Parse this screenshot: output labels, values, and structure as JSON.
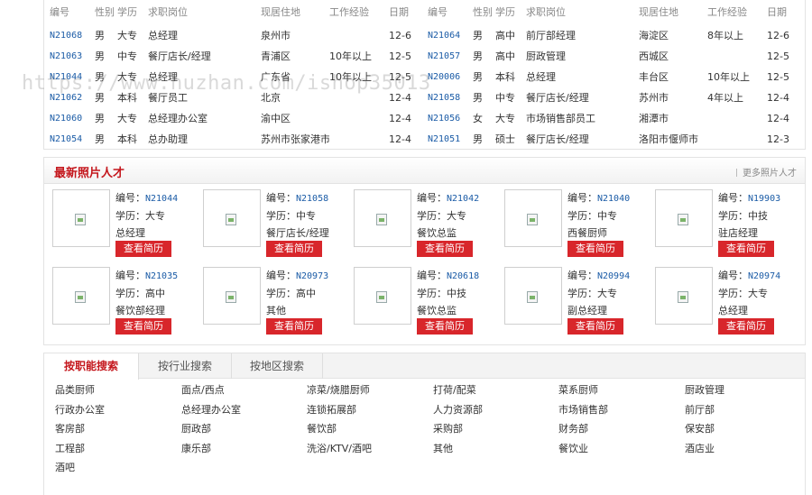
{
  "resume_table": {
    "headers": {
      "id": "编号",
      "sex": "性别",
      "edu": "学历",
      "position": "求职岗位",
      "location": "现居住地",
      "experience": "工作经验",
      "date": "日期"
    },
    "left_rows": [
      {
        "id": "N21068",
        "sex": "男",
        "edu": "大专",
        "position": "总经理",
        "location": "泉州市",
        "experience": "",
        "date": "12-6"
      },
      {
        "id": "N21063",
        "sex": "男",
        "edu": "中专",
        "position": "餐厅店长/经理",
        "location": "青浦区",
        "experience": "10年以上",
        "date": "12-5"
      },
      {
        "id": "N21044",
        "sex": "男",
        "edu": "大专",
        "position": "总经理",
        "location": "广东省",
        "experience": "10年以上",
        "date": "12-5"
      },
      {
        "id": "N21062",
        "sex": "男",
        "edu": "本科",
        "position": "餐厅员工",
        "location": "北京",
        "experience": "",
        "date": "12-4"
      },
      {
        "id": "N21060",
        "sex": "男",
        "edu": "大专",
        "position": "总经理办公室",
        "location": "渝中区",
        "experience": "",
        "date": "12-4"
      },
      {
        "id": "N21054",
        "sex": "男",
        "edu": "本科",
        "position": "总办助理",
        "location": "苏州市张家港市",
        "experience": "",
        "date": "12-4"
      }
    ],
    "right_rows": [
      {
        "id": "N21064",
        "sex": "男",
        "edu": "高中",
        "position": "前厅部经理",
        "location": "海淀区",
        "experience": "8年以上",
        "date": "12-6"
      },
      {
        "id": "N21057",
        "sex": "男",
        "edu": "高中",
        "position": "厨政管理",
        "location": "西城区",
        "experience": "",
        "date": "12-5"
      },
      {
        "id": "N20006",
        "sex": "男",
        "edu": "本科",
        "position": "总经理",
        "location": "丰台区",
        "experience": "10年以上",
        "date": "12-5"
      },
      {
        "id": "N21058",
        "sex": "男",
        "edu": "中专",
        "position": "餐厅店长/经理",
        "location": "苏州市",
        "experience": "4年以上",
        "date": "12-4"
      },
      {
        "id": "N21056",
        "sex": "女",
        "edu": "大专",
        "position": "市场销售部员工",
        "location": "湘潭市",
        "experience": "",
        "date": "12-4"
      },
      {
        "id": "N21051",
        "sex": "男",
        "edu": "硕士",
        "position": "餐厅店长/经理",
        "location": "洛阳市偃师市",
        "experience": "",
        "date": "12-3"
      }
    ]
  },
  "watermark": "https://www.huzhan.com/ishop35013",
  "photo_section": {
    "title": "最新照片人才",
    "more_link": "更多照片人才",
    "button_label": "查看简历",
    "cards": [
      {
        "num_label": "编号：",
        "num": "N21044",
        "edu": "学历：大专",
        "position": "总经理"
      },
      {
        "num_label": "编号：",
        "num": "N21058",
        "edu": "学历：中专",
        "position": "餐厅店长/经理"
      },
      {
        "num_label": "编号：",
        "num": "N21042",
        "edu": "学历：大专",
        "position": "餐饮总监"
      },
      {
        "num_label": "编号：",
        "num": "N21040",
        "edu": "学历：中专",
        "position": "西餐厨师"
      },
      {
        "num_label": "编号：",
        "num": "N19903",
        "edu": "学历：中技",
        "position": "驻店经理"
      },
      {
        "num_label": "编号：",
        "num": "N21035",
        "edu": "学历：高中",
        "position": "餐饮部经理"
      },
      {
        "num_label": "编号：",
        "num": "N20973",
        "edu": "学历：高中",
        "position": "其他"
      },
      {
        "num_label": "编号：",
        "num": "N20618",
        "edu": "学历：中技",
        "position": "餐饮总监"
      },
      {
        "num_label": "编号：",
        "num": "N20994",
        "edu": "学历：大专",
        "position": "副总经理"
      },
      {
        "num_label": "编号：",
        "num": "N20974",
        "edu": "学历：大专",
        "position": "总经理"
      }
    ]
  },
  "search_section": {
    "tabs": [
      "按职能搜索",
      "按行业搜索",
      "按地区搜索"
    ],
    "categories": [
      "品类厨师",
      "面点/西点",
      "凉菜/烧腊厨师",
      "打荷/配菜",
      "菜系厨师",
      "厨政管理",
      "行政办公室",
      "总经理办公室",
      "连锁拓展部",
      "人力资源部",
      "市场销售部",
      "前厅部",
      "客房部",
      "厨政部",
      "餐饮部",
      "采购部",
      "财务部",
      "保安部",
      "工程部",
      "康乐部",
      "洗浴/KTV/酒吧",
      "其他",
      "餐饮业",
      "酒店业",
      "酒吧"
    ]
  },
  "colors": {
    "accent_red": "#c4161c",
    "button_red": "#d8262b",
    "link_blue": "#1a5ba6"
  }
}
